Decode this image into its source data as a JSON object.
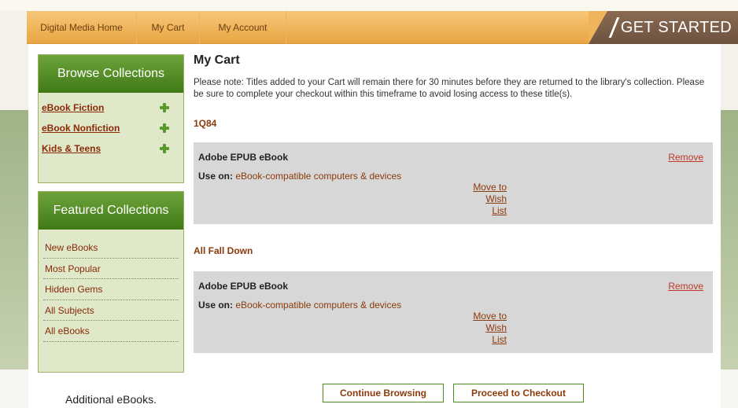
{
  "nav": {
    "home": "Digital Media Home",
    "cart": "My Cart",
    "account": "My Account",
    "get_started": "GET STARTED"
  },
  "sidebar": {
    "browse": {
      "title": "Browse Collections",
      "items": [
        {
          "label": "eBook Fiction"
        },
        {
          "label": "eBook Nonfiction"
        },
        {
          "label": "Kids & Teens"
        }
      ]
    },
    "featured": {
      "title": "Featured Collections",
      "items": [
        {
          "label": "New eBooks"
        },
        {
          "label": "Most Popular"
        },
        {
          "label": "Hidden Gems"
        },
        {
          "label": "All Subjects"
        },
        {
          "label": "All eBooks"
        }
      ]
    },
    "additional": "Additional eBooks."
  },
  "cart": {
    "title": "My Cart",
    "notice": "Please note: Titles added to your Cart will remain there for 30 minutes before they are returned to the library's collection. Please be sure to complete your checkout within this timeframe to avoid losing access to these title(s).",
    "items": [
      {
        "title": "1Q84",
        "format": "Adobe EPUB eBook",
        "use_on_label": "Use on:",
        "use_on_value": "eBook-compatible computers & devices",
        "remove": "Remove",
        "wish": [
          "Move to",
          "Wish",
          "List"
        ]
      },
      {
        "title": "All Fall Down",
        "format": "Adobe EPUB eBook",
        "use_on_label": "Use on:",
        "use_on_value": "eBook-compatible computers & devices",
        "remove": "Remove",
        "wish": [
          "Move to",
          "Wish",
          "List"
        ]
      }
    ],
    "continue_label": "Continue Browsing",
    "checkout_label": "Proceed to Checkout"
  },
  "colors": {
    "nav_orange": "#f0b45a",
    "sidebar_green": "#3f7a17",
    "link_brown": "#8b3a0a",
    "remove_red": "#c0392b",
    "item_box_gray": "#d7d7d7"
  }
}
